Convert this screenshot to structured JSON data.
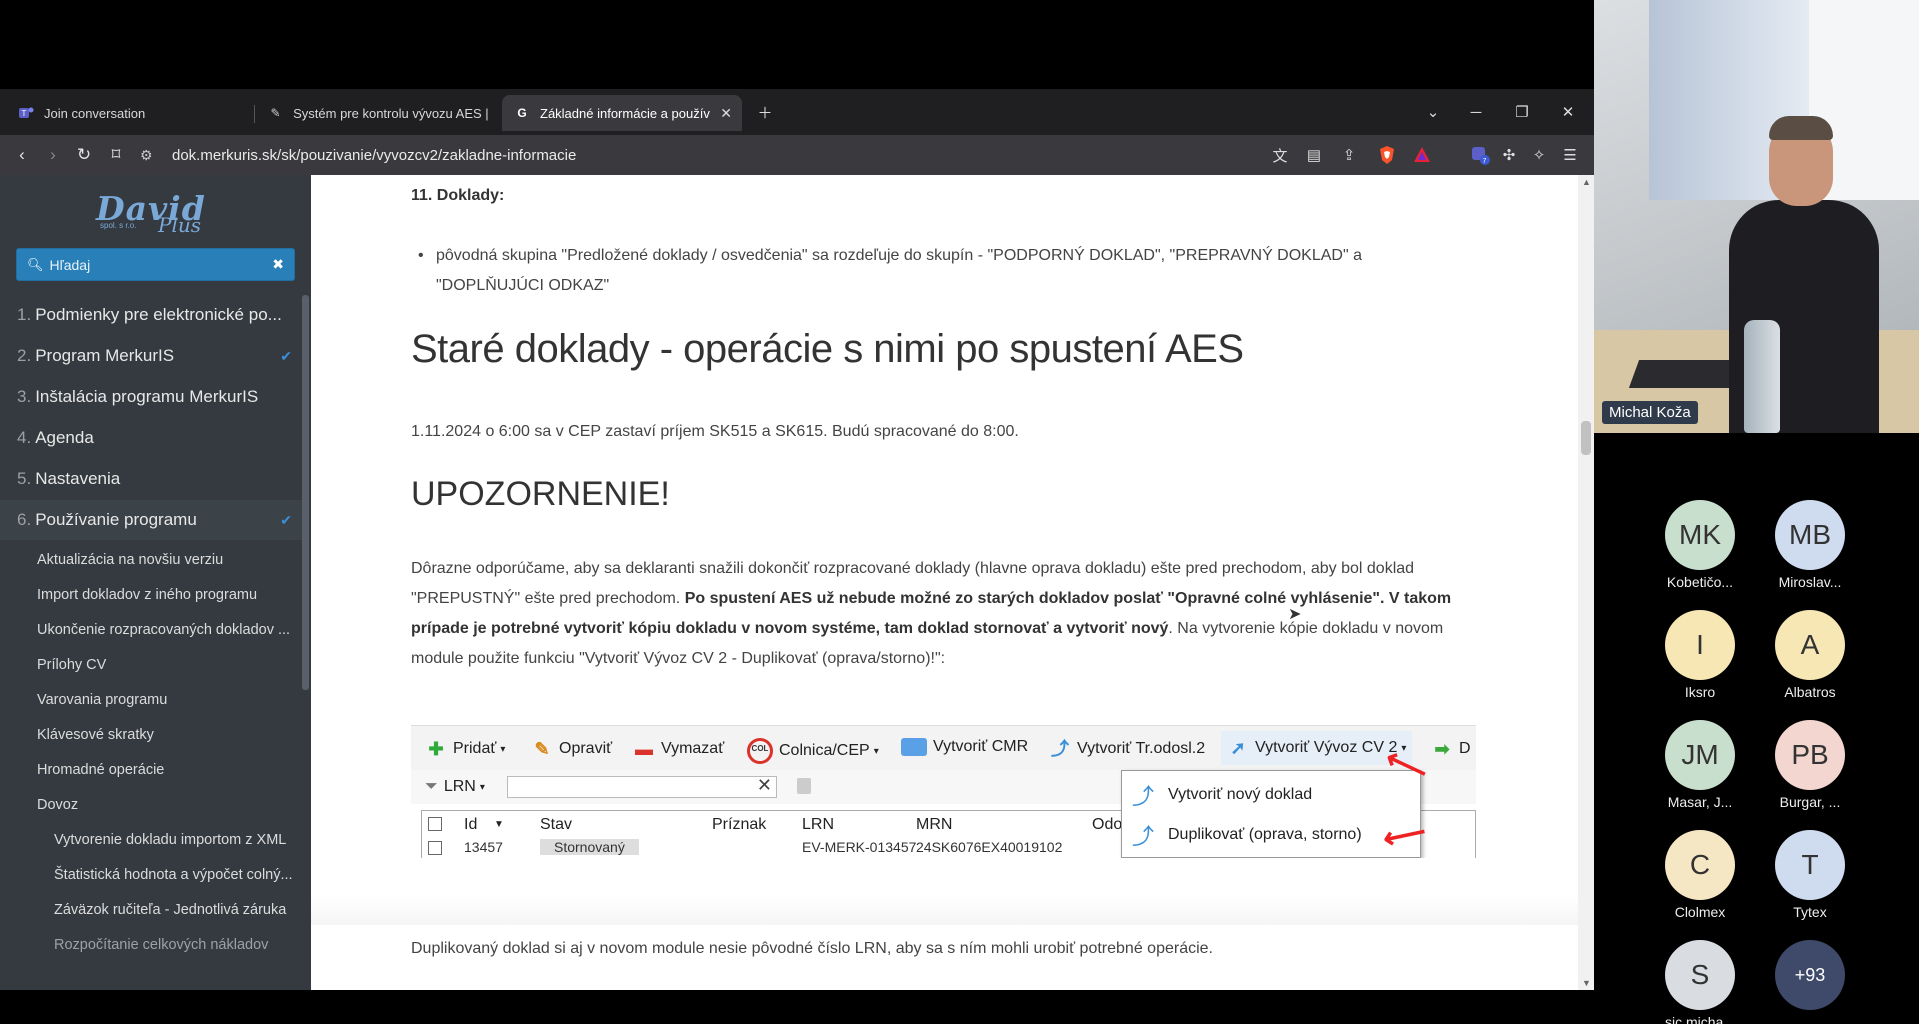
{
  "browser": {
    "tabs": [
      {
        "title": "Join conversation",
        "icon": "teams-icon"
      },
      {
        "title": "Systém pre kontrolu vývozu AES | D",
        "icon": "tool-icon"
      },
      {
        "title": "Základné informácie a používa",
        "icon": "google-icon"
      }
    ],
    "url": "dok.merkuris.sk/sk/pouzivanie/vyvozcv2/zakladne-informacie",
    "extension_badge": "7"
  },
  "sidebar": {
    "logo": {
      "name": "David",
      "sub": "spol. s r.o.",
      "plus": "Plus"
    },
    "search_placeholder": "Hľadaj",
    "items": [
      {
        "num": "1.",
        "label": "Podmienky pre elektronické po..."
      },
      {
        "num": "2.",
        "label": "Program MerkurIS"
      },
      {
        "num": "3.",
        "label": "Inštalácia programu MerkurIS"
      },
      {
        "num": "4.",
        "label": "Agenda"
      },
      {
        "num": "5.",
        "label": "Nastavenia"
      },
      {
        "num": "6.",
        "label": "Používanie programu"
      }
    ],
    "subitems": [
      "Aktualizácia na novšiu verziu",
      "Import dokladov z iného programu",
      "Ukončenie rozpracovaných dokladov ...",
      "Prílohy CV",
      "Varovania programu",
      "Klávesové skratky",
      "Hromadné operácie",
      "Dovoz"
    ],
    "subsubitems": [
      "Vytvorenie dokladu importom z XML",
      "Štatistická hodnota a výpočet colný...",
      "Záväzok ručiteľa - Jednotlivá záruka",
      "Rozpočítanie celkových nákladov"
    ]
  },
  "content": {
    "section_title": "11. Doklady:",
    "bullet": "pôvodná skupina \"Predložené doklady / osvedčenia\" sa rozdeľuje do skupín - \"PODPORNÝ DOKLAD\", \"PREPRAVNÝ DOKLAD\" a \"DOPLŇUJÚCI ODKAZ\"",
    "heading": "Staré doklady - operácie s nimi po spustení AES",
    "paragraph1": "1.11.2024 o 6:00 sa v CEP zastaví príjem SK515 a SK615. Budú spracované do 8:00.",
    "heading2": "UPOZORNENIE!",
    "paragraph2_a": "Dôrazne odporúčame, aby sa deklaranti snažili dokončiť rozpracované doklady (hlavne oprava dokladu) ešte pred prechodom, aby bol doklad \"PREPUSTNÝ\" ešte pred prechodom. ",
    "paragraph2_b": "Po spustení AES už nebude možné zo starých dokladov poslať \"Opravné colné vyhlásenie\". V takom prípade je potrebné vytvoriť kópiu dokladu v novom systéme, tam doklad stornovať a vytvoriť nový",
    "paragraph2_c": ". Na vytvorenie kópie dokladu v novom module použite funkciu \"Vytvoriť Vývoz CV 2 - Duplikovať (oprava/storno)!\":",
    "paragraph3": "Duplikovaný doklad si aj v novom module nesie pôvodné číslo LRN, aby sa s ním mohli urobiť potrebné operácie."
  },
  "screenshot": {
    "toolbar": [
      "Pridať",
      "Opraviť",
      "Vymazať",
      "Colnica/CEP",
      "Vytvoriť CMR",
      "Vytvoriť Tr.odosl.2",
      "Vytvoriť Vývoz CV 2",
      "D"
    ],
    "filter_label": "LRN",
    "columns": [
      "Id",
      "Stav",
      "Príznak",
      "LRN",
      "MRN",
      "Odos"
    ],
    "row": [
      "13457",
      "Stornovaný",
      "",
      "EV-MERK-013457",
      "24SK6076EX40019102",
      ""
    ],
    "menu": [
      "Vytvoriť nový doklad",
      "Duplikovať (oprava, storno)"
    ],
    "col_icon_text": "COL"
  },
  "call": {
    "presenter": "Michal Koža",
    "participants": [
      {
        "initials": "MK",
        "name": "Kobetičo...",
        "color": "#c9dfcd"
      },
      {
        "initials": "MB",
        "name": "Miroslav...",
        "color": "#cfdcf0"
      },
      {
        "initials": "I",
        "name": "Iksro",
        "color": "#f6e7b4"
      },
      {
        "initials": "A",
        "name": "Albatros",
        "color": "#f6e7b4"
      },
      {
        "initials": "JM",
        "name": "Masar, J...",
        "color": "#c9dfcd"
      },
      {
        "initials": "PB",
        "name": "Burgar, ...",
        "color": "#f3d6cf"
      },
      {
        "initials": "C",
        "name": "Clolmex",
        "color": "#f6e7c4"
      },
      {
        "initials": "T",
        "name": "Tytex",
        "color": "#cfdcf0"
      },
      {
        "initials": "S",
        "name": "sic.micha...",
        "color": "#d9dde2"
      },
      {
        "initials": "+93",
        "name": "",
        "color": "#3f4a6b"
      }
    ]
  }
}
